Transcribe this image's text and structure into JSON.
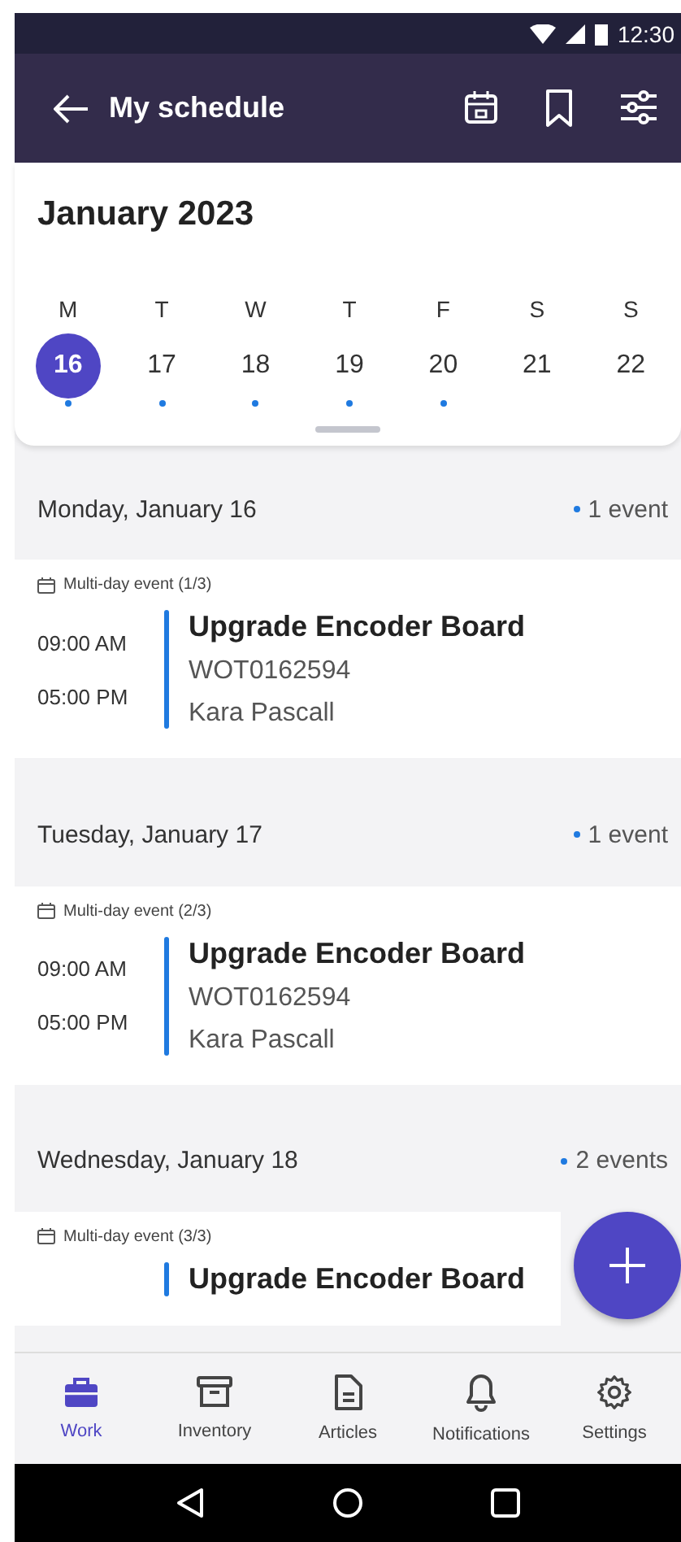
{
  "status_bar": {
    "time": "12:30"
  },
  "app_bar": {
    "title": "My schedule"
  },
  "calendar": {
    "month": "January 2023",
    "days": [
      {
        "weekday": "M",
        "date": "16",
        "selected": true,
        "has_events": true
      },
      {
        "weekday": "T",
        "date": "17",
        "selected": false,
        "has_events": true
      },
      {
        "weekday": "W",
        "date": "18",
        "selected": false,
        "has_events": true
      },
      {
        "weekday": "T",
        "date": "19",
        "selected": false,
        "has_events": true
      },
      {
        "weekday": "F",
        "date": "20",
        "selected": false,
        "has_events": true
      },
      {
        "weekday": "S",
        "date": "21",
        "selected": false,
        "has_events": false
      },
      {
        "weekday": "S",
        "date": "22",
        "selected": false,
        "has_events": false
      }
    ]
  },
  "sections": [
    {
      "heading": "Monday, January 16",
      "count": "1 event",
      "events": [
        {
          "tag": "Multi-day event (1/3)",
          "start": "09:00 AM",
          "end": "05:00 PM",
          "title": "Upgrade Encoder Board",
          "number": "WOT0162594",
          "assignee": "Kara Pascall"
        }
      ]
    },
    {
      "heading": "Tuesday, January 17",
      "count": "1 event",
      "events": [
        {
          "tag": "Multi-day event (2/3)",
          "start": "09:00 AM",
          "end": "05:00 PM",
          "title": "Upgrade Encoder Board",
          "number": "WOT0162594",
          "assignee": "Kara Pascall"
        }
      ]
    },
    {
      "heading": "Wednesday, January 18",
      "count": "2 events",
      "events": [
        {
          "tag": "Multi-day event (3/3)",
          "title": "Upgrade Encoder Board"
        }
      ]
    }
  ],
  "bottom_nav": [
    {
      "kind": "work",
      "label": "Work",
      "selected": true
    },
    {
      "kind": "inventory",
      "label": "Inventory",
      "selected": false
    },
    {
      "kind": "articles",
      "label": "Articles",
      "selected": false
    },
    {
      "kind": "notifications",
      "label": "Notifications",
      "selected": false
    },
    {
      "kind": "settings",
      "label": "Settings",
      "selected": false
    }
  ]
}
